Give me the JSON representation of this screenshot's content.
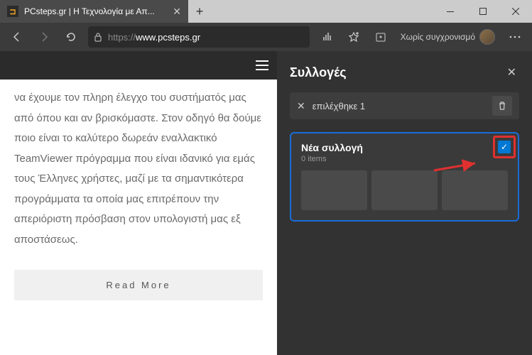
{
  "tab": {
    "title": "PCsteps.gr | Η Τεχνολογία με Απ..."
  },
  "address": {
    "protocol": "https://",
    "host": "www.pcsteps.gr"
  },
  "sync": {
    "label": "Χωρίς συγχρονισμό"
  },
  "article": {
    "text": "να έχουμε τον πληρη έλεγχο του συστήματός μας από όπου και αν βρισκόμαστε. Στον οδηγό θα δούμε ποιο είναι το καλύτερο δωρεάν εναλλακτικό TeamViewer πρόγραμμα που είναι ιδανικό για εμάς τους Έλληνες χρήστες, μαζί με τα σημαντικότερα προγράμματα τα οποία μας επιτρέπουν την απεριόριστη πρόσβαση στον υπολογιστή μας εξ αποστάσεως.",
    "readmore": "Read More"
  },
  "panel": {
    "title": "Συλλογές",
    "selection": "επιλέχθηκε 1",
    "card": {
      "title": "Νέα συλλογή",
      "subtitle": "0 items"
    }
  }
}
